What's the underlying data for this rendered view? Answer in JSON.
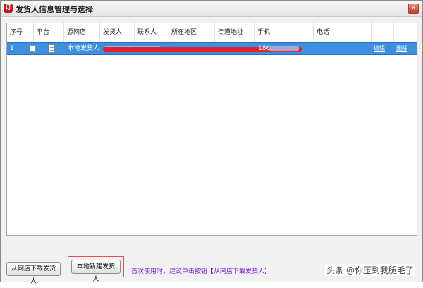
{
  "window": {
    "title": "发货人信息管理与选择",
    "icon": "app-icon",
    "close_icon": "close-icon",
    "close_glyph": "×"
  },
  "table": {
    "columns": [
      "序号",
      "平台",
      "源网店",
      "发货人",
      "联系人",
      "所在地区",
      "街道地址",
      "手机",
      "电话"
    ],
    "rows": [
      {
        "index": "1",
        "source_shop": "本地发货人",
        "mobile_partial": "186",
        "action_edit": "编辑",
        "action_delete": "删除"
      }
    ]
  },
  "footer": {
    "download_button": "从网店下载发货人",
    "new_button": "本地新建发货人",
    "hint": "首次使用时，建议单击按钮【从网店下载发货人】"
  },
  "watermark": "头条 @你压到我腿毛了",
  "colors": {
    "selected_row": "#3d8fe0",
    "redaction": "#e8202a",
    "hint_text": "#7a1fd6",
    "highlight_border": "#e05050"
  }
}
